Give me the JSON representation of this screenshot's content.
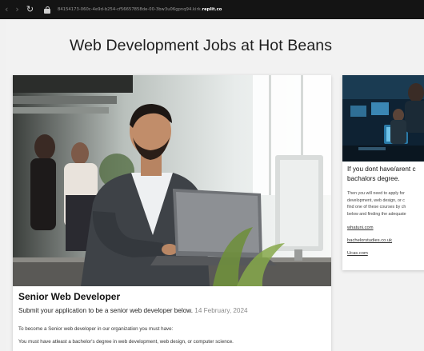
{
  "browser": {
    "url_prefix": "84154173-060c-4e9d-b254-cf56657858de-00-3bw3u06gpnq94.kirk.",
    "url_domain": "replit.co"
  },
  "page": {
    "title": "Web Development Jobs at Hot Beans"
  },
  "jobs": [
    {
      "title": "Senior Web Developer",
      "subtitle": "Submit your application to be a senior web developer below.",
      "date": "14 February, 2024",
      "paragraphs": [
        "To become a Senior web developer in our organization you must have:",
        "You must have atleast a bachelor's degree in web development, web design, or computer science."
      ]
    }
  ],
  "info_card": {
    "heading_line1": "If you dont have/arent c",
    "heading_line2": "bachalors degree.",
    "body_lines": [
      "Then you will need to apply for",
      "development, web design, or c",
      "find one of these courses by ch",
      "below and finding the adequate"
    ],
    "links": [
      "whatuni.com",
      "bachelorstudies.co.uk",
      "Ucas.com"
    ]
  }
}
